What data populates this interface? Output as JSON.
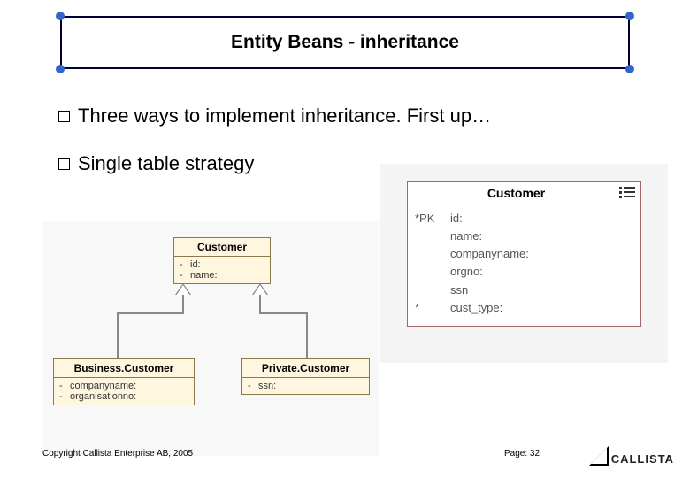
{
  "title": "Entity Beans - inheritance",
  "bullets": [
    "Three ways to implement inheritance. First up…",
    "Single table strategy"
  ],
  "uml": {
    "parent": {
      "name": "Customer",
      "attrs": [
        {
          "vis": "-",
          "text": "id:"
        },
        {
          "vis": "-",
          "text": "name:"
        }
      ]
    },
    "left": {
      "name": "Business.Customer",
      "attrs": [
        {
          "vis": "-",
          "text": "companyname:"
        },
        {
          "vis": "-",
          "text": "organisationno:"
        }
      ]
    },
    "right": {
      "name": "Private.Customer",
      "attrs": [
        {
          "vis": "-",
          "text": "ssn:"
        }
      ]
    }
  },
  "db": {
    "name": "Customer",
    "columns": [
      {
        "key": "*PK",
        "name": "id:"
      },
      {
        "key": "",
        "name": "name:"
      },
      {
        "key": "",
        "name": "companyname:"
      },
      {
        "key": "",
        "name": "orgno:"
      },
      {
        "key": "",
        "name": "ssn"
      },
      {
        "key": "*",
        "name": "cust_type:"
      }
    ]
  },
  "footer": {
    "copyright": "Copyright Callista Enterprise AB, 2005",
    "page_prefix": "Page: ",
    "page_number": "32",
    "logo_text": "CALLISTA"
  }
}
